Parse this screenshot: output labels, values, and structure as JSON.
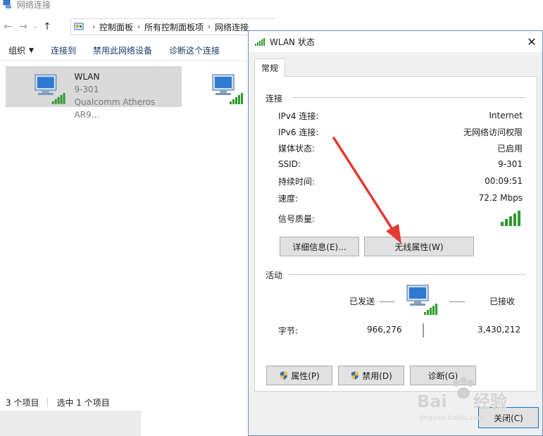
{
  "explorer": {
    "title": "网络连接",
    "breadcrumbs": [
      "控制面板",
      "所有控制面板项",
      "网络连接"
    ],
    "toolbar": {
      "organize": "组织",
      "connect_to": "连接到",
      "disable_device": "禁用此网络设备",
      "diagnose": "诊断这个连接"
    },
    "items": [
      {
        "name": "WLAN",
        "ssid": "9-301",
        "adapter": "Qualcomm Atheros AR9..."
      }
    ],
    "status": {
      "count": "3 个项目",
      "selected": "选中 1 个项目"
    }
  },
  "dialog": {
    "title": "WLAN 状态",
    "tab": "常规",
    "connection": {
      "title": "连接",
      "rows": [
        {
          "label": "IPv4 连接:",
          "value": "Internet"
        },
        {
          "label": "IPv6 连接:",
          "value": "无网络访问权限"
        },
        {
          "label": "媒体状态:",
          "value": "已启用"
        },
        {
          "label": "SSID:",
          "value": "9-301"
        },
        {
          "label": "持续时间:",
          "value": "00:09:51"
        },
        {
          "label": "速度:",
          "value": "72.2 Mbps"
        }
      ],
      "signal_label": "信号质量:",
      "signal_bars": 5
    },
    "buttons": {
      "details": "详细信息(E)...",
      "wireless_props": "无线属性(W)",
      "properties": "属性(P)",
      "disable": "禁用(D)",
      "diagnose": "诊断(G)",
      "close": "关闭(C)"
    },
    "activity": {
      "title": "活动",
      "sent_label": "已发送",
      "received_label": "已接收",
      "bytes_label": "字节:",
      "bytes_sent": "966,276",
      "bytes_received": "3,430,212"
    }
  },
  "colors": {
    "signal_green": "#2e9a2e",
    "annotation_red": "#e53935",
    "selection": "#d9d9d9"
  }
}
